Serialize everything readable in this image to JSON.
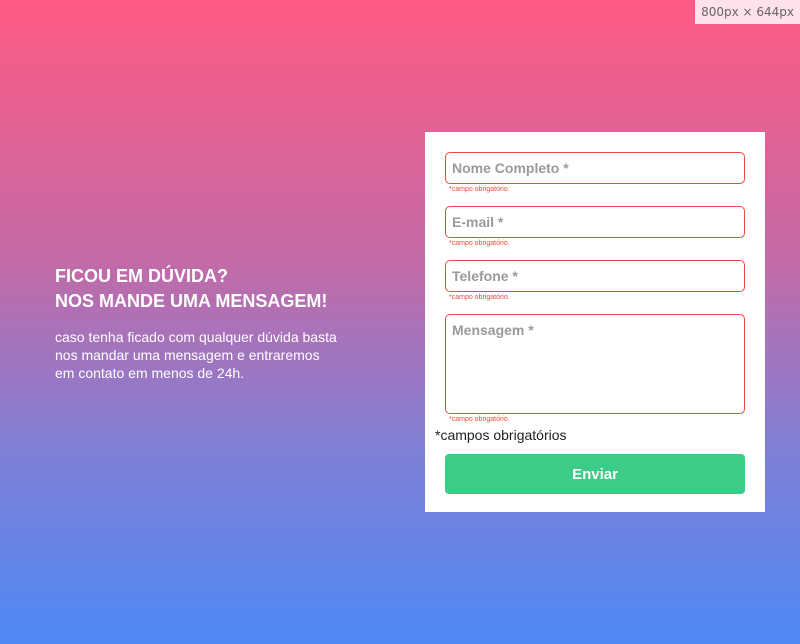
{
  "dimension_badge": "800px × 644px",
  "hero": {
    "title_line_1": "FICOU EM DÚVIDA?",
    "title_line_2": "NOS MANDE UMA MENSAGEM!",
    "description": "caso tenha ficado com qualquer dúvida basta nos mandar uma mensagem e entraremos em contato em menos de 24h."
  },
  "form": {
    "fields": [
      {
        "placeholder": "Nome Completo *",
        "error": "*campo obrigatório."
      },
      {
        "placeholder": "E-mail *",
        "error": "*campo obrigatório."
      },
      {
        "placeholder": "Telefone *",
        "error": "*campo obrigatório."
      },
      {
        "placeholder": "Mensagem *",
        "error": "*campo obrigatório."
      }
    ],
    "required_note": "*campos obrigatórios",
    "submit_label": "Enviar"
  }
}
